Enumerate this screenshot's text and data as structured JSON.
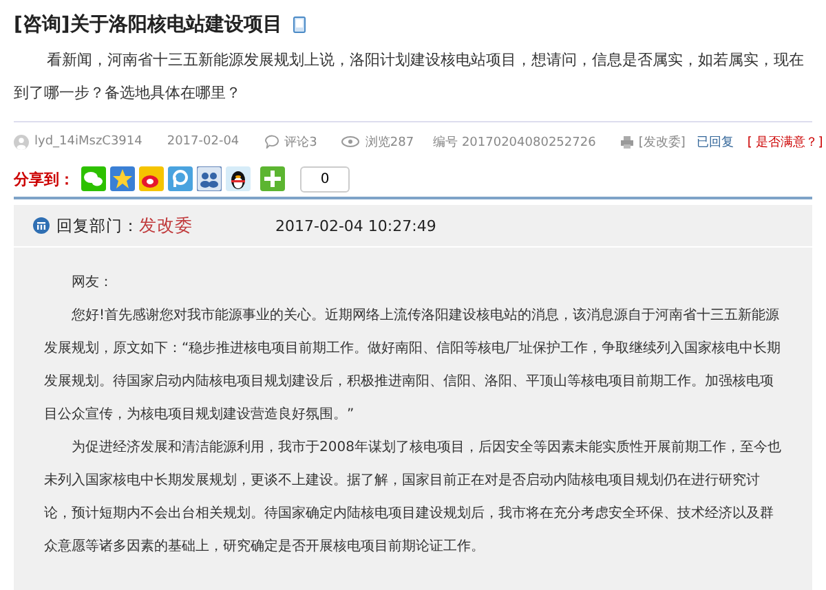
{
  "question": {
    "title": "[咨询]关于洛阳核电站建设项目",
    "body": "看新闻，河南省十三五新能源发展规划上说，洛阳计划建设核电站项目，想请问，信息是否属实，如若属实，现在到了哪一步？备选地具体在哪里？"
  },
  "meta": {
    "user": "lyd_14iMszC3914",
    "date": "2017-02-04",
    "comments": "评论3",
    "views": "浏览287",
    "number": "编号 20170204080252726",
    "department": "[发改委]",
    "status": "已回复",
    "satisfaction": "[ 是否满意？]"
  },
  "share": {
    "label": "分享到：",
    "services": [
      {
        "kind": "chat"
      },
      {
        "kind": "star"
      },
      {
        "kind": "eye"
      },
      {
        "kind": "circle"
      },
      {
        "kind": "people"
      },
      {
        "kind": "penguin"
      },
      {
        "kind": "plus"
      }
    ],
    "count": "0"
  },
  "reply": {
    "department_label": "回复部门：",
    "department": "发改委",
    "time": "2017-02-04 10:27:49",
    "greeting": "网友：",
    "paragraphs": [
      "您好!首先感谢您对我市能源事业的关心。近期网络上流传洛阳建设核电站的消息，该消息源自于河南省十三五新能源发展规划，原文如下：“稳步推进核电项目前期工作。做好南阳、信阳等核电厂址保护工作，争取继续列入国家核电中长期发展规划。待国家启动内陆核电项目规划建设后，积极推进南阳、信阳、洛阳、平顶山等核电项目前期工作。加强核电项目公众宣传，为核电项目规划建设营造良好氛围。”",
      "为促进经济发展和清洁能源利用，我市于2008年谋划了核电项目，后因安全等因素未能实质性开展前期工作，至今也未列入国家核电中长期发展规划，更谈不上建设。据了解，国家目前正在对是否启动内陆核电项目规划仍在进行研究讨论，预计短期内不会出台相关规划。待国家确定内陆核电项目建设规划后，我市将在充分考虑安全环保、技术经济以及群众意愿等诸多因素的基础上，研究确定是否开展核电项目前期论证工作。"
    ]
  }
}
